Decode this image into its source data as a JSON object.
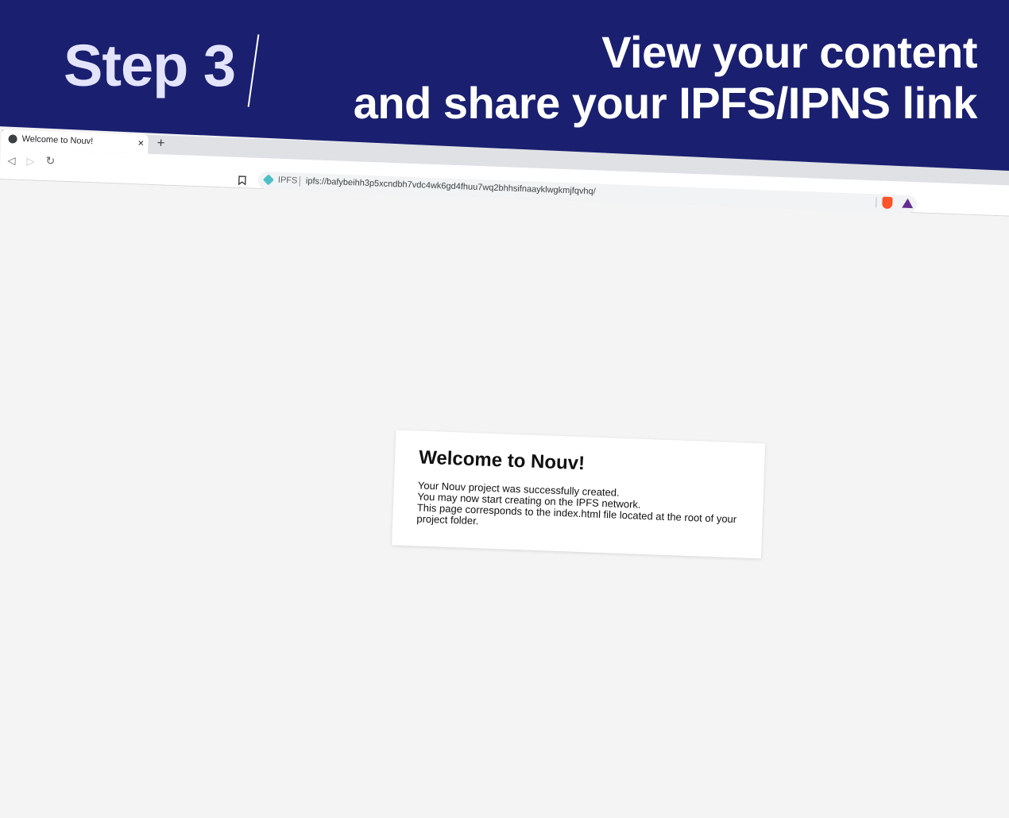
{
  "banner": {
    "step": "Step 3",
    "headline_line1": "View your content",
    "headline_line2": "and share your IPFS/IPNS link"
  },
  "browser": {
    "tab_title": "Welcome to Nouv!",
    "tab_close": "×",
    "new_tab": "+",
    "nav": {
      "back": "◁",
      "forward": "▷",
      "reload": "↻"
    },
    "bookmark": "🔖",
    "omnibox": {
      "ipfs_label": "IPFS",
      "url": "ipfs://bafybeihh3p5xcndbh7vdc4wk6gd4fhuu7wq2bhhsifnaayklwgkmjfqvhq/"
    }
  },
  "page": {
    "heading": "Welcome to Nouv!",
    "line1": "Your Nouv project was successfully created.",
    "line2": "You may now start creating on the IPFS network.",
    "line3": "This page corresponds to the index.html file located at the root of your project folder."
  },
  "colors": {
    "banner_bg": "#1a1f70",
    "step_text": "#e3e4fb",
    "headline_text": "#ffffff",
    "ipfs_teal": "#4fbfc6",
    "brave_orange": "#fb542b",
    "bat_purple": "#662d91"
  }
}
